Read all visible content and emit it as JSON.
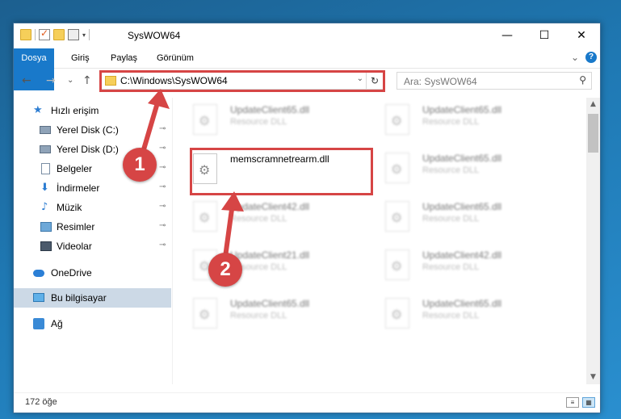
{
  "window": {
    "title": "SysWOW64",
    "minimize_glyph": "—",
    "maximize_glyph": "☐",
    "close_glyph": "✕"
  },
  "ribbon": {
    "tabs": [
      "Dosya",
      "Giriş",
      "Paylaş",
      "Görünüm"
    ],
    "expand_glyph": "⌄",
    "help_glyph": "?"
  },
  "nav": {
    "back_glyph": "←",
    "forward_glyph": "→",
    "recent_glyph": "⌄",
    "up_glyph": "↑",
    "address": "C:\\Windows\\SysWOW64",
    "dropdown_glyph": "⌄",
    "refresh_glyph": "↻",
    "search_placeholder": "Ara: SysWOW64",
    "search_glyph": "⚲"
  },
  "sidebar": {
    "items": [
      {
        "label": "Hızlı erişim",
        "icon": "star-icon",
        "pinned": false
      },
      {
        "label": "Yerel Disk (C:)",
        "icon": "disk-icon",
        "pinned": true
      },
      {
        "label": "Yerel Disk (D:)",
        "icon": "disk-icon",
        "pinned": true
      },
      {
        "label": "Belgeler",
        "icon": "document-icon",
        "pinned": true
      },
      {
        "label": "İndirmeler",
        "icon": "download-icon",
        "pinned": true
      },
      {
        "label": "Müzik",
        "icon": "music-icon",
        "pinned": true
      },
      {
        "label": "Resimler",
        "icon": "picture-icon",
        "pinned": true
      },
      {
        "label": "Videolar",
        "icon": "video-icon",
        "pinned": true
      },
      {
        "label": "OneDrive",
        "icon": "cloud-icon",
        "pinned": false
      },
      {
        "label": "Bu bilgisayar",
        "icon": "computer-icon",
        "pinned": false,
        "selected": true
      },
      {
        "label": "Ağ",
        "icon": "network-icon",
        "pinned": false
      }
    ],
    "pin_glyph": "📌"
  },
  "files": {
    "highlighted": {
      "name": "memscramnetrearm.dll"
    },
    "left_column": [
      {
        "name": "UpdateClient65.dll",
        "type": "Resource DLL"
      },
      {
        "name": "UpdateClient42.dll",
        "type": "Resource DLL"
      },
      {
        "name": "UpdateClient21.dll",
        "type": "Resource DLL"
      },
      {
        "name": "UpdateClient65.dll",
        "type": "Resource DLL"
      }
    ],
    "right_column": [
      {
        "name": "UpdateClient65.dll",
        "type": "Resource DLL"
      },
      {
        "name": "UpdateClient65.dll",
        "type": "Resource DLL"
      },
      {
        "name": "UpdateClient65.dll",
        "type": "Resource DLL"
      },
      {
        "name": "UpdateClient42.dll",
        "type": "Resource DLL"
      },
      {
        "name": "UpdateClient65.dll",
        "type": "Resource DLL"
      }
    ]
  },
  "status": {
    "item_count": "172 öğe"
  },
  "annotations": {
    "step1": "1",
    "step2": "2",
    "highlight_color": "#d64545"
  }
}
